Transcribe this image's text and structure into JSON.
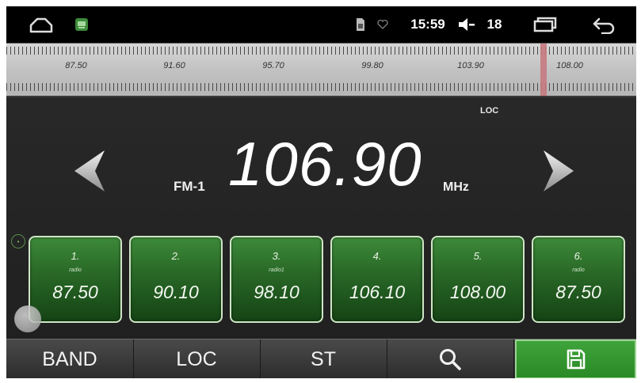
{
  "status_bar": {
    "time": "15:59",
    "volume_level": "18",
    "icons": [
      "home-icon",
      "radio-app-icon",
      "sim-card-icon",
      "heart-icon",
      "speaker-icon",
      "recent-apps-icon",
      "back-icon"
    ]
  },
  "dial": {
    "labels": [
      "87.50",
      "91.60",
      "95.70",
      "99.80",
      "103.90",
      "108.00"
    ],
    "range_mhz": [
      87.5,
      108.0
    ],
    "current_mhz": 106.9,
    "needle_color": "#c77a80"
  },
  "display": {
    "loc_indicator": "LOC",
    "band": "FM-1",
    "frequency": "106.90",
    "unit": "MHz"
  },
  "presets": [
    {
      "number": "1.",
      "name": "radio",
      "freq": "87.50"
    },
    {
      "number": "2.",
      "name": "",
      "freq": "90.10"
    },
    {
      "number": "3.",
      "name": "radio1",
      "freq": "98.10"
    },
    {
      "number": "4.",
      "name": "",
      "freq": "106.10"
    },
    {
      "number": "5.",
      "name": "",
      "freq": "108.00"
    },
    {
      "number": "6.",
      "name": "radio",
      "freq": "87.50"
    }
  ],
  "bottom_bar": {
    "band_label": "BAND",
    "loc_label": "LOC",
    "st_label": "ST",
    "search_icon": "search-icon",
    "save_icon": "save-icon"
  },
  "colors": {
    "preset_green": "#2a6a28",
    "save_green": "#2a8a26",
    "background": "#242424"
  }
}
